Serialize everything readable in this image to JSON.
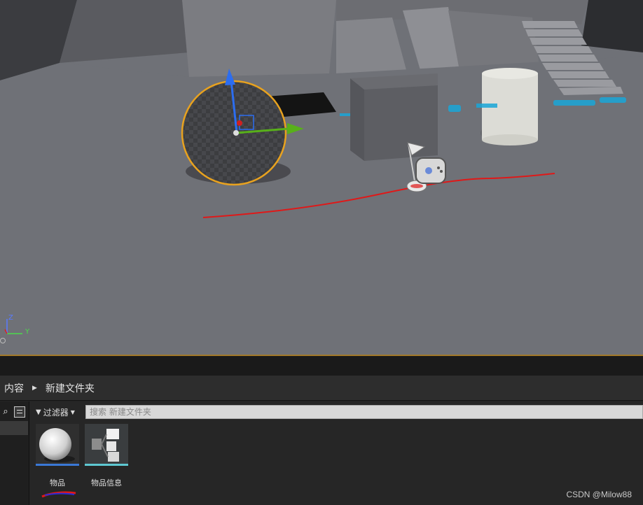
{
  "viewport": {
    "axis_labels": {
      "z": "Z",
      "y": "Y"
    }
  },
  "breadcrumb": [
    {
      "label": "内容"
    },
    {
      "label": "新建文件夹"
    }
  ],
  "content_browser": {
    "filter_label": "过滤器",
    "search_placeholder": "搜索 新建文件夹",
    "assets": [
      {
        "label": "物品",
        "type_color": "#3a78d6",
        "icon": "sphere-material-icon"
      },
      {
        "label": "物品信息",
        "type_color": "#5ec8d2",
        "icon": "data-asset-icon"
      }
    ]
  },
  "watermark": "CSDN @Milow88",
  "colors": {
    "selection_outline": "#e8a21f",
    "spline": "#e01818",
    "gizmo_z": "#2c6df0",
    "gizmo_y": "#58b01a"
  }
}
